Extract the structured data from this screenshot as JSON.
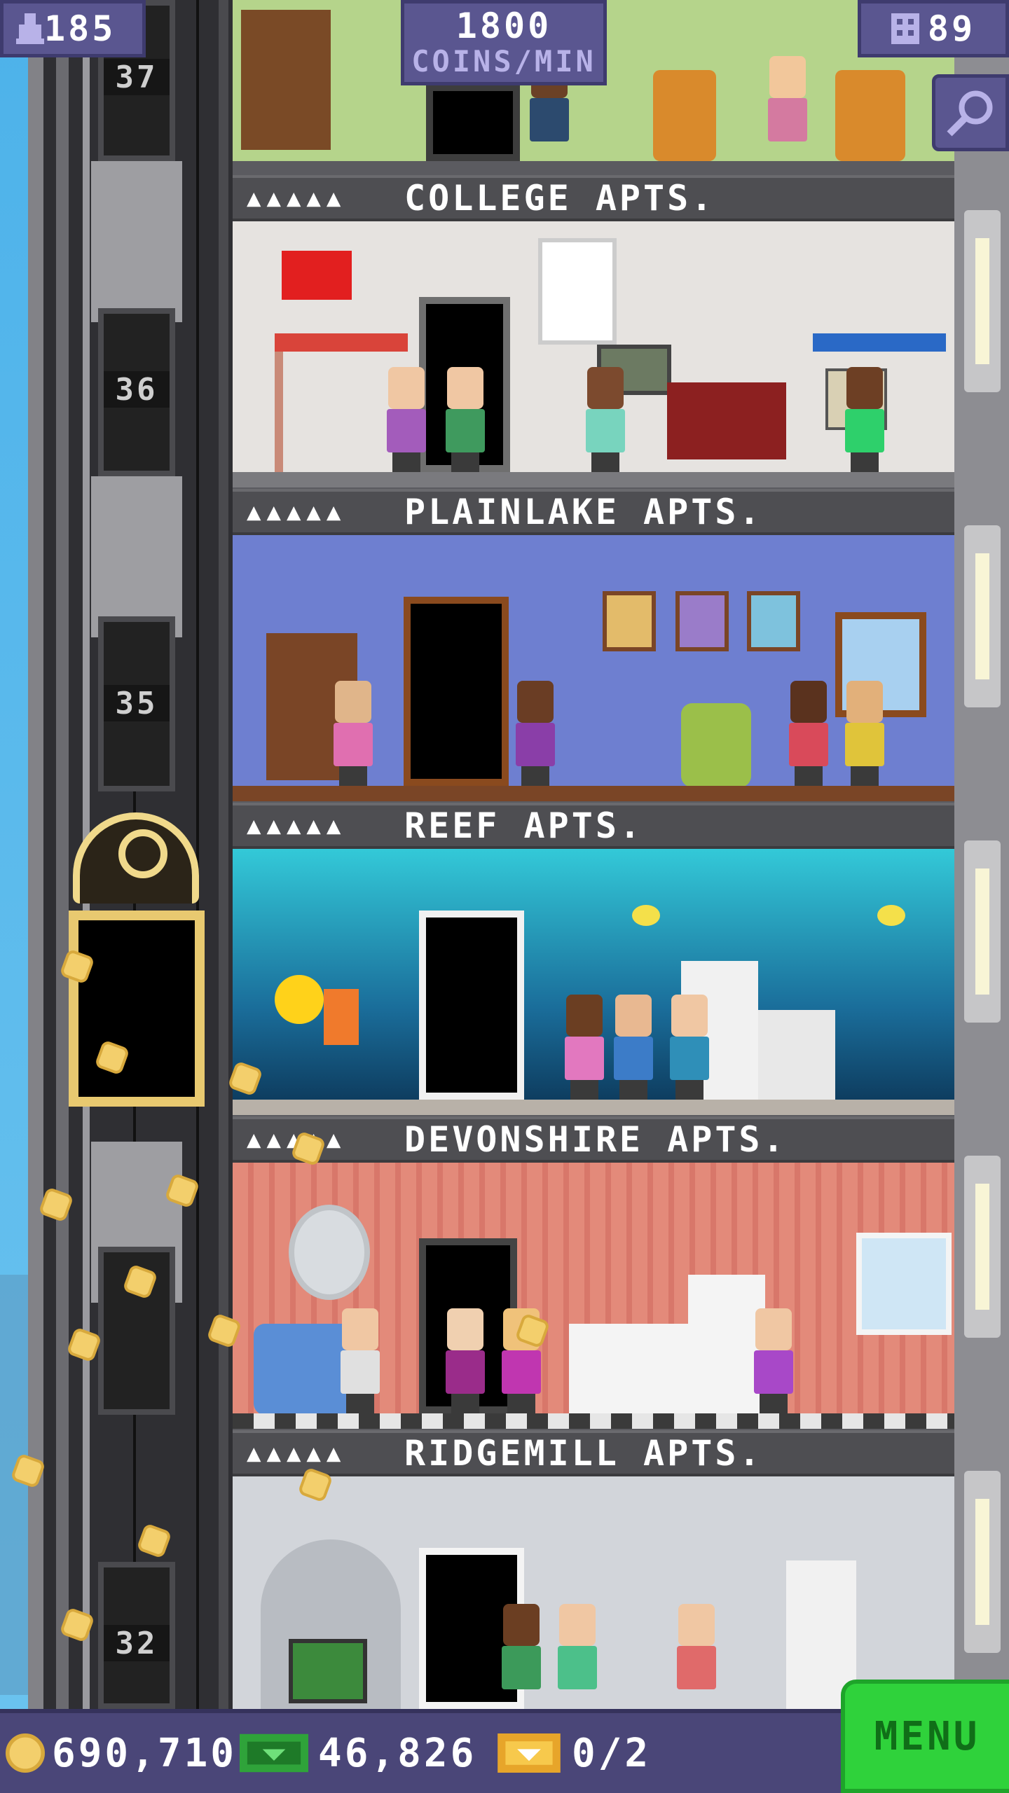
{
  "hud": {
    "population": "185",
    "coins_rate_value": "1800",
    "coins_rate_unit": "COINS/MIN",
    "floors": "89"
  },
  "elevator": {
    "floor_numbers": [
      "37",
      "36",
      "35",
      "32"
    ]
  },
  "floors": [
    {
      "name": "COLLEGE APTS.",
      "residents": "▲▲▲▲▲"
    },
    {
      "name": "PLAINLAKE APTS.",
      "residents": "▲▲▲▲▲"
    },
    {
      "name": "REEF APTS.",
      "residents": "▲▲▲▲▲"
    },
    {
      "name": "DEVONSHIRE APTS.",
      "residents": "▲▲▲▲▲"
    },
    {
      "name": "RIDGEMILL APTS.",
      "residents": "▲▲▲▲▲"
    }
  ],
  "bottom_bar": {
    "coins": "690,710",
    "bux": "46,826",
    "tickets": "0/2",
    "menu_label": "MENU"
  },
  "colors": {
    "hud_bg": "#5a5690",
    "menu_green": "#2fd23b",
    "coin_gold": "#f3cf6c",
    "bux_green": "#2fa33a"
  },
  "icons": [
    "person-icon",
    "building-icon",
    "search-icon",
    "coin-icon",
    "bux-icon",
    "ticket-icon"
  ]
}
